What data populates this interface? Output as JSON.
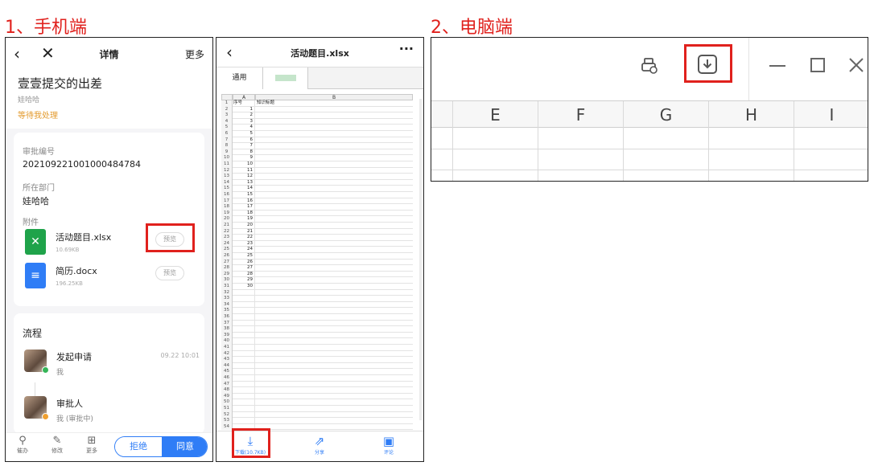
{
  "section1_title": "1、手机端",
  "section2_title": "2、电脑端",
  "mobile": {
    "nav_title": "详情",
    "nav_more": "更多",
    "header_title": "壹壹提交的出差",
    "header_user": "娃哈哈",
    "header_status": "等待我处理",
    "approval_no_label": "审批编号",
    "approval_no": "202109221001000484784",
    "dept_label": "所在部门",
    "dept": "娃哈哈",
    "attach_label": "附件",
    "files": [
      {
        "name": "活动题目.xlsx",
        "size": "10.69KB",
        "preview": "预览"
      },
      {
        "name": "简历.docx",
        "size": "196.25KB",
        "preview": "预览"
      }
    ],
    "flow_title": "流程",
    "flow": [
      {
        "name": "发起申请",
        "sub": "我",
        "time": "09.22 10:01"
      },
      {
        "name": "审批人",
        "sub": "我 (审批中)",
        "time": ""
      }
    ],
    "toolbar": [
      {
        "icon": "pin-icon",
        "label": "催办"
      },
      {
        "icon": "edit-icon",
        "label": "修改"
      },
      {
        "icon": "grid-icon",
        "label": "更多"
      }
    ],
    "reject_label": "拒绝",
    "agree_label": "同意"
  },
  "sheet": {
    "nav_title": "活动题目.xlsx",
    "tabs": [
      "通用",
      ""
    ],
    "col_a": "A",
    "col_b": "B",
    "header_row": {
      "num": "1",
      "a": "序号",
      "b": "知识标题"
    },
    "rows_with_values": 30,
    "total_rows": 54,
    "download_label": "下载(10.7KB)",
    "share_label": "分享",
    "comment_label": "评论"
  },
  "desktop": {
    "columns": [
      "E",
      "F",
      "G",
      "H",
      "I"
    ]
  },
  "colors": {
    "highlight": "#e0211d",
    "accent": "#2f7df6",
    "excel_green": "#1fa34a"
  }
}
